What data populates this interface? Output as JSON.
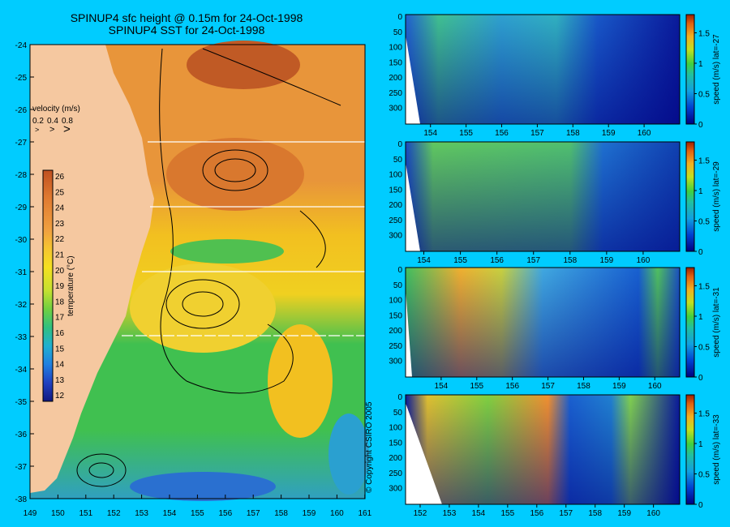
{
  "map": {
    "title1": "SPINUP4 sfc height @ 0.15m for 24-Oct-1998",
    "title2": "SPINUP4 SST for 24-Oct-1998",
    "velocity_label": "velocity (m/s)",
    "velocity_scale": [
      "0.2",
      "0.4",
      "0.8"
    ],
    "lat_ticks": [
      "-24",
      "-25",
      "-26",
      "-27",
      "-28",
      "-29",
      "-30",
      "-31",
      "-32",
      "-33",
      "-34",
      "-35",
      "-36",
      "-37",
      "-38"
    ],
    "lon_ticks": [
      "149",
      "150",
      "151",
      "152",
      "153",
      "154",
      "155",
      "156",
      "157",
      "158",
      "159",
      "160",
      "161"
    ],
    "colorbar_label": "temperature (°C)",
    "colorbar_ticks": [
      "26",
      "25",
      "24",
      "23",
      "22",
      "21",
      "20",
      "19",
      "18",
      "17",
      "16",
      "15",
      "14",
      "13",
      "12"
    ],
    "copyright": "© Copyright CSIRO 2005",
    "section_lats": [
      -27,
      -29,
      -31,
      -33
    ]
  },
  "sections": [
    {
      "lat_label": "speed (m/s) lat=-27",
      "lon_ticks": [
        "154",
        "155",
        "156",
        "157",
        "158",
        "159",
        "160"
      ],
      "lon_range": [
        153.3,
        161
      ]
    },
    {
      "lat_label": "speed (m/s) lat=-29",
      "lon_ticks": [
        "154",
        "155",
        "156",
        "157",
        "158",
        "159",
        "160"
      ],
      "lon_range": [
        153.5,
        161
      ]
    },
    {
      "lat_label": "speed (m/s) lat=-31",
      "lon_ticks": [
        "154",
        "155",
        "156",
        "157",
        "158",
        "159",
        "160"
      ],
      "lon_range": [
        153.0,
        160.7
      ]
    },
    {
      "lat_label": "speed (m/s) lat=-33",
      "lon_ticks": [
        "152",
        "153",
        "154",
        "155",
        "156",
        "157",
        "158",
        "159",
        "160"
      ],
      "lon_range": [
        151.5,
        160.9
      ]
    }
  ],
  "section_depth_ticks": [
    "0",
    "50",
    "100",
    "150",
    "200",
    "250",
    "300"
  ],
  "section_colorbar_ticks": [
    "1.5",
    "1",
    "0.5",
    "0"
  ],
  "chart_data": [
    {
      "type": "heatmap",
      "title": "SPINUP4 SST for 24-Oct-1998",
      "xlim": [
        149,
        161
      ],
      "ylim": [
        -38,
        -24
      ],
      "colorbar": {
        "label": "temperature (°C)",
        "range": [
          11.5,
          26.5
        ]
      }
    },
    {
      "type": "heatmap",
      "ylabel": "speed (m/s) lat=-27",
      "xlim": [
        153.3,
        161
      ],
      "ylim": [
        350,
        0
      ],
      "colorbar": {
        "range": [
          0,
          1.8
        ]
      }
    },
    {
      "type": "heatmap",
      "ylabel": "speed (m/s) lat=-29",
      "xlim": [
        153.5,
        161
      ],
      "ylim": [
        350,
        0
      ],
      "colorbar": {
        "range": [
          0,
          1.8
        ]
      }
    },
    {
      "type": "heatmap",
      "ylabel": "speed (m/s) lat=-31",
      "xlim": [
        153.0,
        160.7
      ],
      "ylim": [
        350,
        0
      ],
      "colorbar": {
        "range": [
          0,
          1.8
        ]
      }
    },
    {
      "type": "heatmap",
      "ylabel": "speed (m/s) lat=-33",
      "xlim": [
        151.5,
        160.9
      ],
      "ylim": [
        350,
        0
      ],
      "colorbar": {
        "range": [
          0,
          1.8
        ]
      }
    }
  ]
}
